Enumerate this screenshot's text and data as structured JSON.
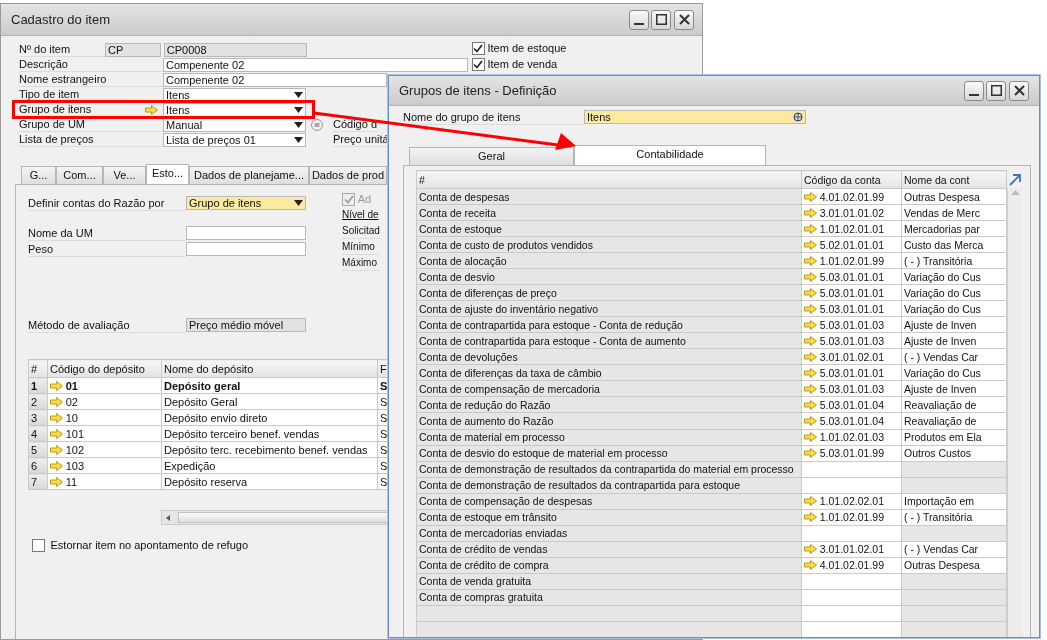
{
  "item_window": {
    "title": "Cadastro do item",
    "item_number": {
      "label": "Nº do item",
      "series": "CP",
      "value": "CP0008"
    },
    "fields": [
      {
        "label": "Descrição",
        "value": "Compenente 02",
        "kind": "text"
      },
      {
        "label": "Nome estrangeiro",
        "value": "Compenente 02",
        "kind": "text"
      },
      {
        "label": "Tipo de item",
        "value": "Itens",
        "kind": "select"
      },
      {
        "label": "Grupo de itens",
        "value": "Itens",
        "kind": "select",
        "link": true
      },
      {
        "label": "Grupo de UM",
        "value": "Manual",
        "kind": "select",
        "side_label": "Código d"
      },
      {
        "label": "Lista de preços",
        "value": "Lista de preços 01",
        "kind": "select",
        "side_label": "Preço unitá"
      }
    ],
    "flags": [
      {
        "label": "Item de estoque",
        "checked": true
      },
      {
        "label": "Item de venda",
        "checked": true
      }
    ],
    "tabs": [
      {
        "label": "G...",
        "selected": false
      },
      {
        "label": "Com...",
        "selected": false
      },
      {
        "label": "Ve...",
        "selected": false
      },
      {
        "label": "Esto...",
        "selected": true
      },
      {
        "label": "Dados de planejame...",
        "selected": false
      },
      {
        "label": "Dados de prod",
        "selected": false
      }
    ],
    "inventory_fields": [
      {
        "label": "Definir contas do Razão por",
        "value": "Grupo de itens",
        "kind": "select"
      },
      {
        "label": "Nome da UM",
        "kind": "text"
      },
      {
        "label": "Peso",
        "kind": "text"
      },
      {
        "label": "Método de avaliação",
        "value": "Preço médio móvel",
        "kind": "readonly"
      }
    ],
    "admin_check": {
      "label": "Ad",
      "checked": true,
      "disabled": true
    },
    "level_labels": [
      {
        "label": "Nível de",
        "kind": "link"
      },
      {
        "label": "Solicitad",
        "kind": "text"
      },
      {
        "label": "Mínimo",
        "kind": "text"
      },
      {
        "label": "Máximo",
        "kind": "text"
      }
    ],
    "warehouses": {
      "columns": [
        "#",
        "Código do depósito",
        "Nome do depósito",
        "F"
      ],
      "rows": [
        {
          "number": "1",
          "code": "01",
          "name": "Depósito geral",
          "col_4": "S",
          "default": true
        },
        {
          "number": "2",
          "code": "02",
          "name": "Depósito Geral",
          "col_4": "S",
          "default": false
        },
        {
          "number": "3",
          "code": "10",
          "name": "Depósito envio direto",
          "col_4": "S",
          "default": false
        },
        {
          "number": "4",
          "code": "101",
          "name": "Depósito terceiro benef. vendas",
          "col_4": "S",
          "default": false
        },
        {
          "number": "5",
          "code": "102",
          "name": "Depósito terc. recebimento benef. vendas",
          "col_4": "S",
          "default": false
        },
        {
          "number": "6",
          "code": "103",
          "name": "Expedição",
          "col_4": "S",
          "default": false
        },
        {
          "number": "7",
          "code": "11",
          "name": "Depósito reserva",
          "col_4": "S",
          "default": false
        }
      ]
    },
    "reverse_scrap": {
      "label": "Estornar item no apontamento de refugo",
      "checked": false
    }
  },
  "group_window": {
    "title": "Grupos de itens - Definição",
    "name_field": {
      "label": "Nome do grupo de itens",
      "value": "Itens"
    },
    "tabs": [
      {
        "label": "Geral",
        "selected": false
      },
      {
        "label": "Contabilidade",
        "selected": true
      }
    ],
    "accounts": {
      "columns": [
        "#",
        "Código da conta",
        "Nome da cont"
      ],
      "rows": [
        {
          "name": "Conta de despesas",
          "code": "4.01.02.01.99",
          "account_name": "Outras Despesa"
        },
        {
          "name": "Conta de receita",
          "code": "3.01.01.01.02",
          "account_name": "Vendas de Merc"
        },
        {
          "name": "Conta de estoque",
          "code": "1.01.02.01.01",
          "account_name": "Mercadorias par"
        },
        {
          "name": "Conta de custo de produtos vendidos",
          "code": "5.02.01.01.01",
          "account_name": "Custo das Merca"
        },
        {
          "name": "Conta de alocação",
          "code": "1.01.02.01.99",
          "account_name": "( - ) Transitória"
        },
        {
          "name": "Conta de desvio",
          "code": "5.03.01.01.01",
          "account_name": "Variação do Cus"
        },
        {
          "name": "Conta de diferenças de preço",
          "code": "5.03.01.01.01",
          "account_name": "Variação do Cus"
        },
        {
          "name": "Conta de ajuste do inventário negativo",
          "code": "5.03.01.01.01",
          "account_name": "Variação do Cus"
        },
        {
          "name": "Conta de contrapartida para estoque - Conta de redução",
          "code": "5.03.01.01.03",
          "account_name": "Ajuste de Inven"
        },
        {
          "name": "Conta de contrapartida para estoque - Conta de aumento",
          "code": "5.03.01.01.03",
          "account_name": "Ajuste de Inven"
        },
        {
          "name": "Conta de devoluções",
          "code": "3.01.01.02.01",
          "account_name": "( - ) Vendas Car"
        },
        {
          "name": "Conta de diferenças da taxa de câmbio",
          "code": "5.03.01.01.01",
          "account_name": "Variação do Cus"
        },
        {
          "name": "Conta de compensação de mercadoria",
          "code": "5.03.01.01.03",
          "account_name": "Ajuste de Inven"
        },
        {
          "name": "Conta de redução do Razão",
          "code": "5.03.01.01.04",
          "account_name": "Reavaliação de"
        },
        {
          "name": "Conta de aumento do Razão",
          "code": "5.03.01.01.04",
          "account_name": "Reavaliação de"
        },
        {
          "name": "Conta de material em processo",
          "code": "1.01.02.01.03",
          "account_name": "Produtos em Ela"
        },
        {
          "name": "Conta de desvio do estoque de material em processo",
          "code": "5.03.01.01.99",
          "account_name": "Outros Custos"
        },
        {
          "name": "Conta de demonstração de resultados da contrapartida do material em processo"
        },
        {
          "name": "Conta de demonstração de resultados da contrapartida para estoque"
        },
        {
          "name": "Conta de compensação de despesas",
          "code": "1.01.02.02.01",
          "account_name": "Importação em"
        },
        {
          "name": "Conta de estoque em trânsito",
          "code": "1.01.02.01.99",
          "account_name": "( - ) Transitória"
        },
        {
          "name": "Conta de mercadorias enviadas"
        },
        {
          "name": "Conta de crédito de vendas",
          "code": "3.01.01.02.01",
          "account_name": "( - ) Vendas Car"
        },
        {
          "name": "Conta de crédito de compra",
          "code": "4.01.02.01.99",
          "account_name": "Outras Despesa"
        },
        {
          "name": "Conta de venda gratuita"
        },
        {
          "name": "Conta de compras gratuita"
        }
      ]
    }
  }
}
